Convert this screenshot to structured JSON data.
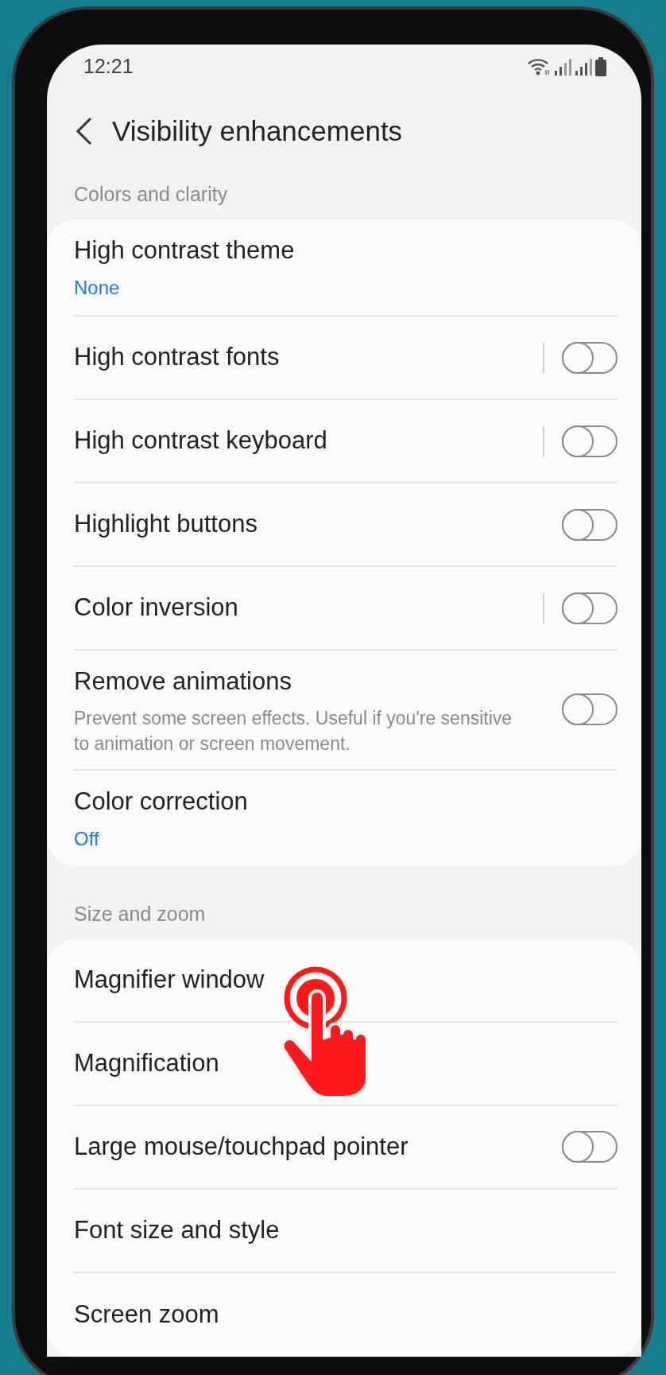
{
  "status_bar": {
    "time": "12:21"
  },
  "header": {
    "title": "Visibility enhancements"
  },
  "sections": [
    {
      "title": "Colors and clarity",
      "rows": [
        {
          "kind": "value",
          "title": "High contrast theme",
          "value": "None"
        },
        {
          "kind": "toggle",
          "title": "High contrast fonts",
          "divider": true,
          "on": false
        },
        {
          "kind": "toggle",
          "title": "High contrast keyboard",
          "divider": true,
          "on": false
        },
        {
          "kind": "toggle",
          "title": "Highlight buttons",
          "divider": false,
          "on": false
        },
        {
          "kind": "toggle",
          "title": "Color inversion",
          "divider": true,
          "on": false
        },
        {
          "kind": "toggle",
          "title": "Remove animations",
          "description": "Prevent some screen effects. Useful if you're sensitive to animation or screen movement.",
          "divider": false,
          "on": false
        },
        {
          "kind": "value",
          "title": "Color correction",
          "value": "Off"
        }
      ]
    },
    {
      "title": "Size and zoom",
      "rows": [
        {
          "kind": "plain",
          "title": "Magnifier window"
        },
        {
          "kind": "plain",
          "title": "Magnification"
        },
        {
          "kind": "toggle",
          "title": "Large mouse/touchpad pointer",
          "divider": false,
          "on": false
        },
        {
          "kind": "plain",
          "title": "Font size and style"
        },
        {
          "kind": "plain",
          "title": "Screen zoom"
        }
      ]
    }
  ]
}
